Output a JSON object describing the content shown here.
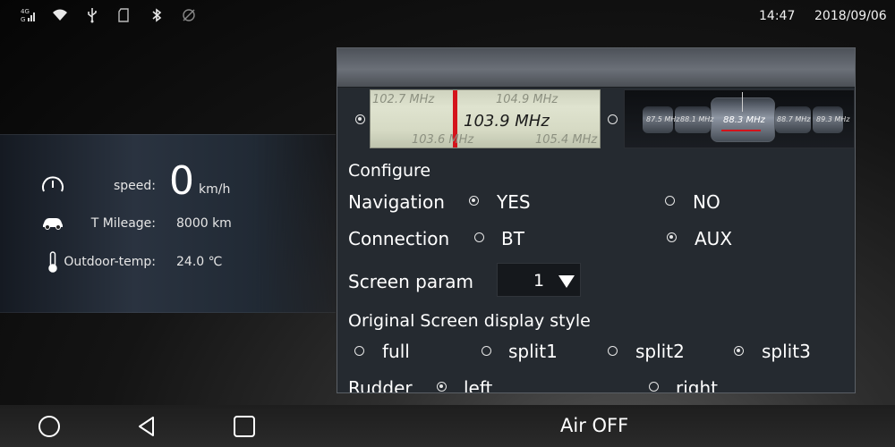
{
  "status_bar": {
    "network_label": "4G",
    "time": "14:47",
    "date": "2018/09/06",
    "icons": [
      "signal-4g-icon",
      "wifi-icon",
      "usb-icon",
      "sd-card-icon",
      "bluetooth-icon",
      "gps-off-icon"
    ]
  },
  "info": {
    "speed_label": "speed:",
    "speed_value": "0",
    "speed_unit": "km/h",
    "mileage_label": "T Mileage:",
    "mileage_value": "8000 km",
    "temp_label": "Outdoor-temp:",
    "temp_value": "24.0 ℃",
    "icons": [
      "speedometer-icon",
      "car-icon",
      "thermometer-icon"
    ]
  },
  "dialog": {
    "tuner_style1": {
      "selected": true,
      "freq_top_left": "102.7 MHz",
      "freq_top_right": "104.9 MHz",
      "freq_main": "103.9 MHz",
      "freq_bottom_left": "103.6 MHz",
      "freq_bottom_right": "105.4 MHz"
    },
    "tuner_style2": {
      "selected": false,
      "freq_left2": "87.5 MHz",
      "freq_left": "88.1 MHz",
      "freq_main": "88.3 MHz",
      "freq_right": "88.7 MHz",
      "freq_right2": "89.3 MHz"
    },
    "configure_title": "Configure",
    "navigation": {
      "label": "Navigation",
      "yes": "YES",
      "no": "NO",
      "selected": "YES"
    },
    "connection": {
      "label": "Connection",
      "bt": "BT",
      "aux": "AUX",
      "selected": "AUX"
    },
    "screen_param": {
      "label": "Screen param",
      "value": "1"
    },
    "display_style": {
      "label": "Original Screen display style",
      "options": [
        "full",
        "split1",
        "split2",
        "split3"
      ],
      "selected": "split3"
    },
    "rudder": {
      "label": "Rudder",
      "left": "left",
      "right": "right",
      "selected": "left"
    }
  },
  "navbar": {
    "air_status": "Air OFF",
    "buttons": [
      "home-circle-icon",
      "back-triangle-icon",
      "recents-square-icon"
    ]
  }
}
